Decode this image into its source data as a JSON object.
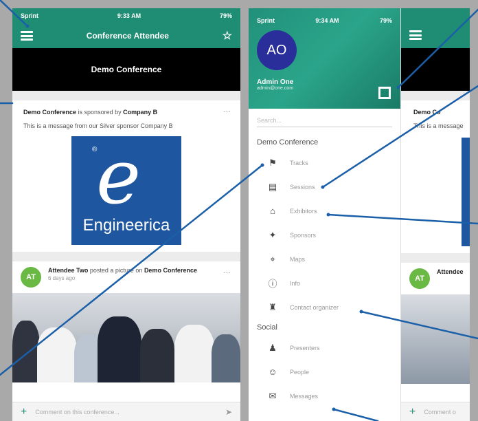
{
  "left_screen": {
    "status": {
      "carrier": "Sprint",
      "time": "9:33 AM",
      "battery": "79%"
    },
    "appbar": {
      "title": "Conference Attendee"
    },
    "banner": {
      "text": "Demo Conference"
    },
    "sponsor_card": {
      "conference": "Demo Conference",
      "sponsored_by": "is sponsored by",
      "sponsor": "Company B",
      "message": "This is a message from our Silver sponsor Company B",
      "logo_text": "Engineerica"
    },
    "post": {
      "avatar": "AT",
      "author": "Attendee Two",
      "action": "posted a picture on",
      "target": "Demo Conference",
      "time": "6 days ago"
    },
    "comment": {
      "placeholder": "Comment on this conference..."
    }
  },
  "right_screen": {
    "status": {
      "carrier": "Sprint",
      "time": "9:34 AM",
      "battery": "79%"
    },
    "user": {
      "initials": "AO",
      "name": "Admin One",
      "email": "admin@one.com"
    },
    "search": {
      "placeholder": "Search..."
    },
    "sections": [
      {
        "title": "Demo Conference",
        "items": [
          {
            "label": "Tracks",
            "icon": "tracks-icon"
          },
          {
            "label": "Sessions",
            "icon": "sessions-icon"
          },
          {
            "label": "Exhibitors",
            "icon": "exhibitors-icon"
          },
          {
            "label": "Sponsors",
            "icon": "sponsors-icon"
          },
          {
            "label": "Maps",
            "icon": "maps-icon"
          },
          {
            "label": "Info",
            "icon": "info-icon"
          },
          {
            "label": "Contact organizer",
            "icon": "contact-icon"
          }
        ]
      },
      {
        "title": "Social",
        "items": [
          {
            "label": "Presenters",
            "icon": "presenters-icon"
          },
          {
            "label": "People",
            "icon": "people-icon"
          },
          {
            "label": "Messages",
            "icon": "messages-icon"
          }
        ]
      }
    ],
    "behind": {
      "sponsor_fragment": "Demo Co",
      "message_fragment": "This is a message",
      "post_fragment": "Attendee",
      "comment_fragment": "Comment o",
      "avatar": "AT"
    }
  },
  "colors": {
    "primary": "#1f8c74",
    "avatar_at": "#6ab944",
    "avatar_ao": "#2a2e9a",
    "logo_bg": "#1e56a0",
    "callout": "#1a5fa8"
  }
}
